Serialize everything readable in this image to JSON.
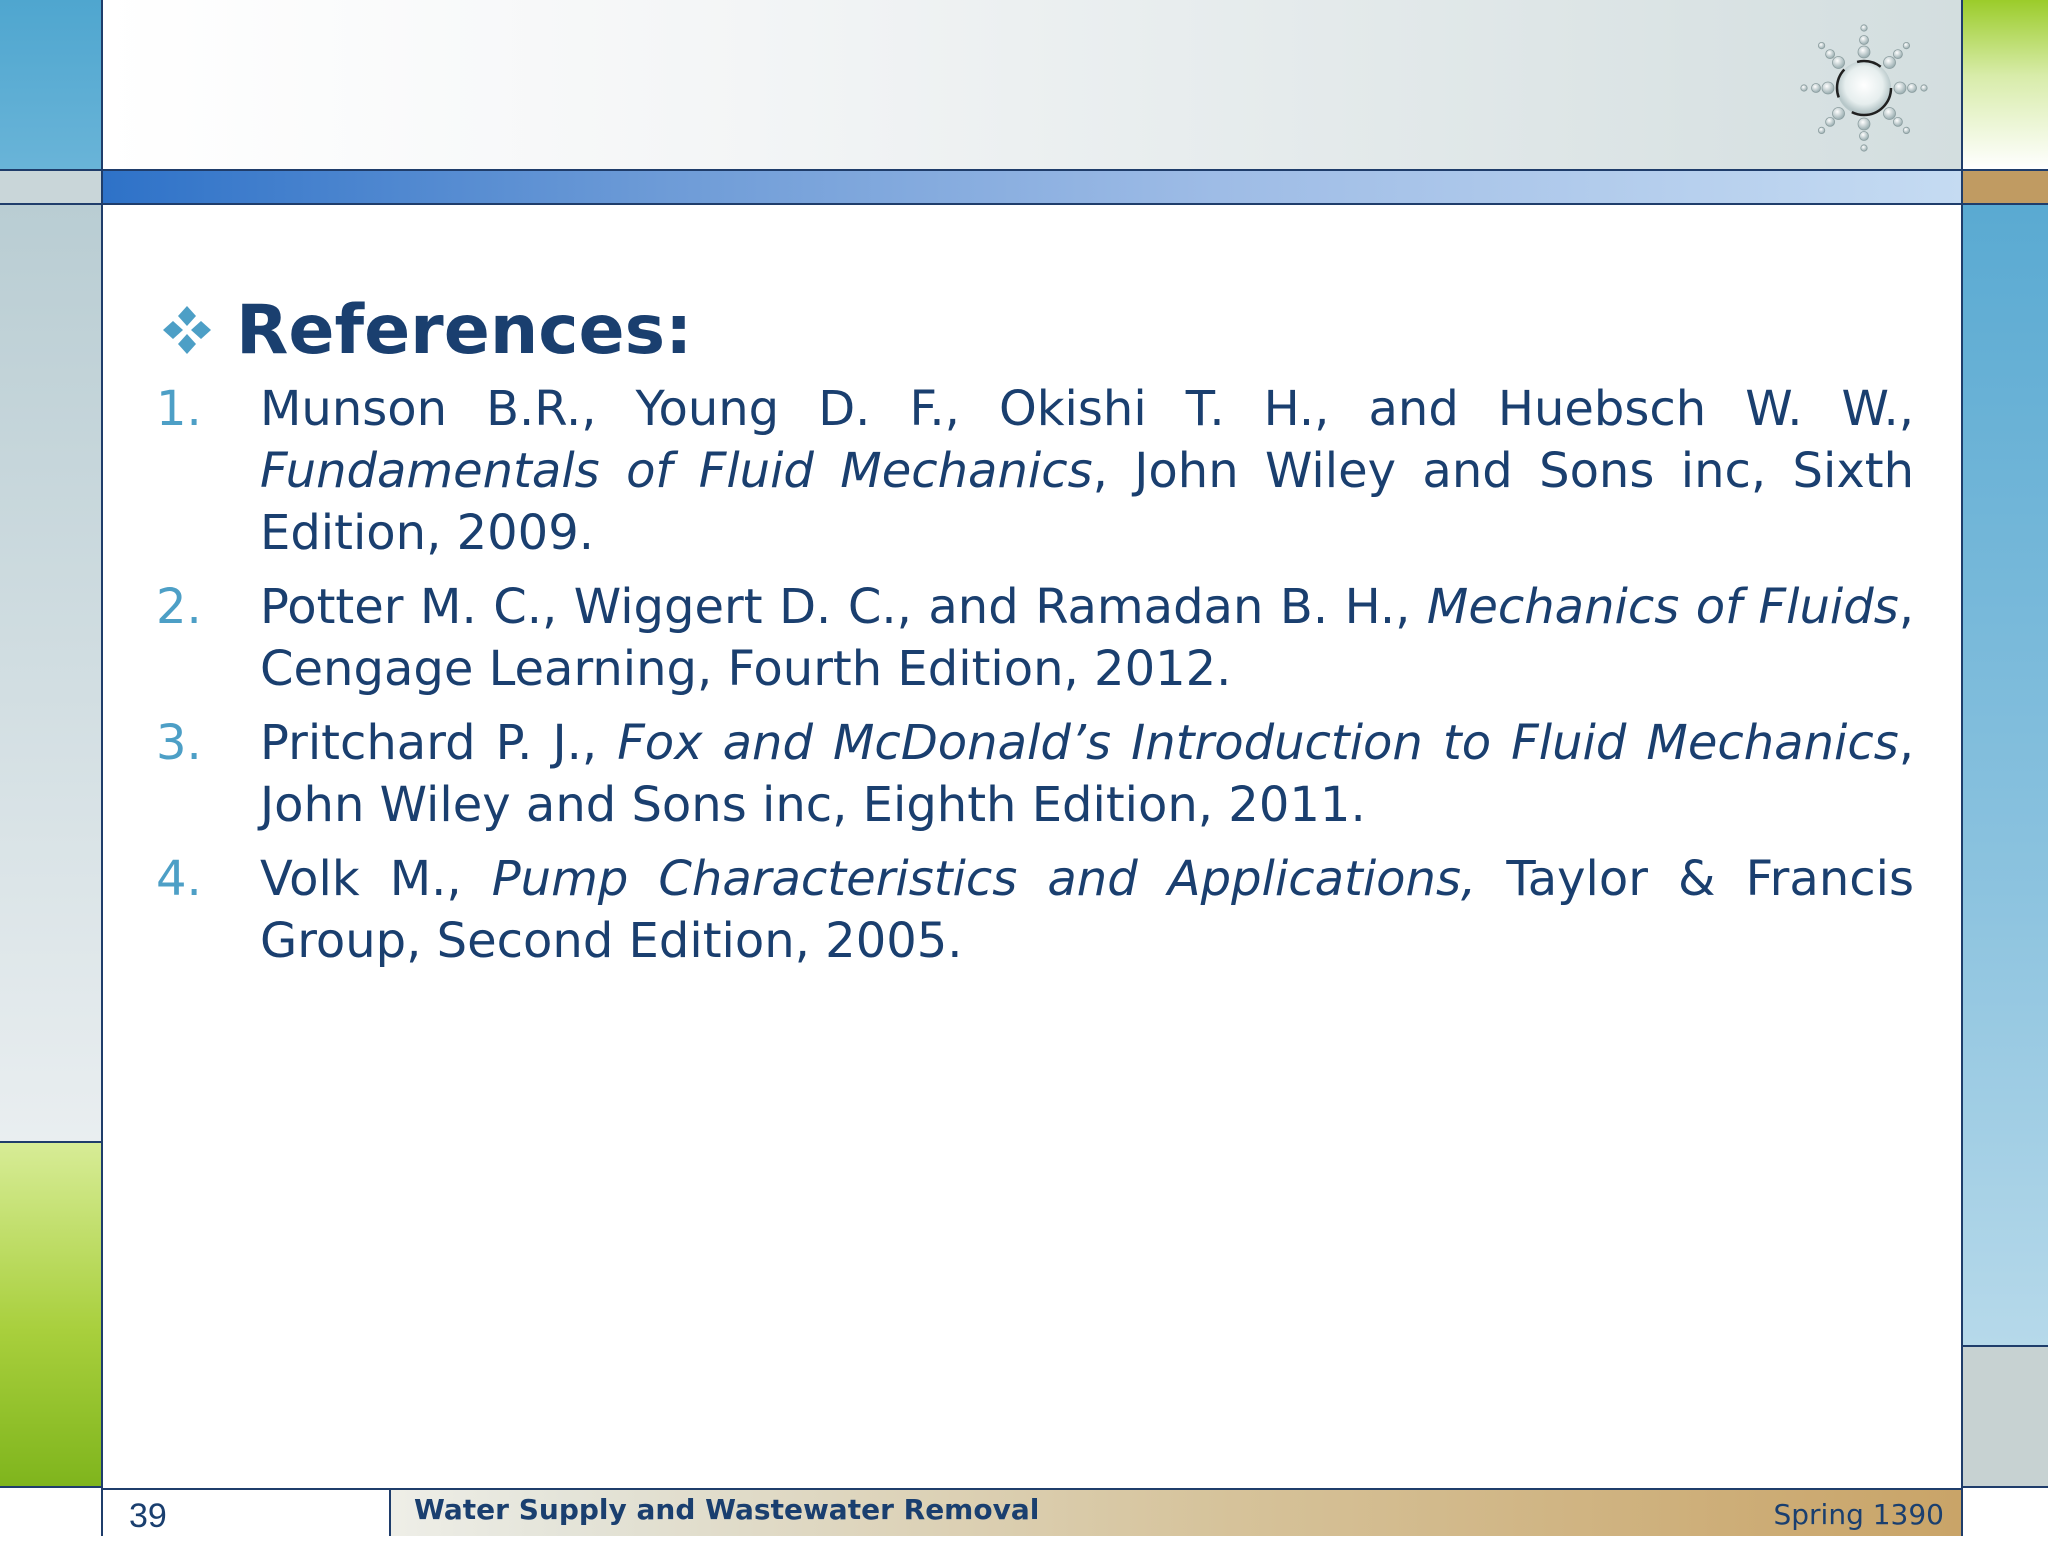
{
  "slide": {
    "heading": "References:",
    "references": [
      {
        "num": "1.",
        "pre": "Munson B.R., Young D. F., Okishi T. H., and Huebsch W. W.,  ",
        "title": "Fundamentals of Fluid Mechanics",
        "post": ", John Wiley and Sons inc, Sixth Edition, 2009."
      },
      {
        "num": "2.",
        "pre": "Potter M. C., Wiggert D. C., and Ramadan B. H., ",
        "title": "Mechanics of Fluids",
        "post": ", Cengage Learning, Fourth Edition, 2012."
      },
      {
        "num": "3.",
        "pre": "Pritchard P. J., ",
        "title": "Fox and McDonald’s Introduction to Fluid Mechanics",
        "post": ", John Wiley and Sons inc, Eighth Edition, 2011."
      },
      {
        "num": "4.",
        "pre": "Volk M., ",
        "title": "Pump Characteristics and Applications,",
        "post": " Taylor & Francis Group, Second Edition, 2005."
      }
    ]
  },
  "footer": {
    "slide_number": "39",
    "course_title": "Water Supply and Wastewater Removal",
    "semester": "Spring 1390"
  },
  "icons": {
    "bullet": "four-diamond-bullet-icon",
    "logo": "sun-logo-icon"
  },
  "colors": {
    "text": "#1a3f6f",
    "number": "#4d9fc6",
    "bullet": "#4d9fc6"
  }
}
